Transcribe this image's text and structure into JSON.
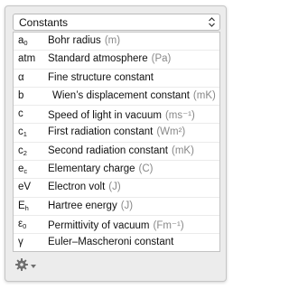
{
  "dropdown": {
    "label": "Constants",
    "icon": "chevron-up-down-icon"
  },
  "constants": [
    {
      "symbol": "a",
      "sub": "0",
      "name": "Bohr radius",
      "unit": "(m)"
    },
    {
      "symbol": "atm",
      "sub": "",
      "name": "Standard atmosphere",
      "unit": "(Pa)"
    },
    {
      "symbol": "α",
      "sub": "",
      "name": "Fine structure constant",
      "unit": ""
    },
    {
      "symbol": "b",
      "sub": "",
      "name": "Wien’s displacement constant",
      "unit": "(mK)"
    },
    {
      "symbol": "c",
      "sub": "",
      "name": "Speed of light in vacuum",
      "unit": "(ms⁻¹)"
    },
    {
      "symbol": "c",
      "sub": "1",
      "name": "First radiation constant",
      "unit": "(Wm²)"
    },
    {
      "symbol": "c",
      "sub": "2",
      "name": "Second radiation constant",
      "unit": "(mK)"
    },
    {
      "symbol": "e",
      "sub": "c",
      "name": "Elementary charge",
      "unit": "(C)"
    },
    {
      "symbol": "eV",
      "sub": "",
      "name": "Electron volt",
      "unit": "(J)"
    },
    {
      "symbol": "E",
      "sub": "h",
      "name": "Hartree energy",
      "unit": "(J)"
    },
    {
      "symbol": "ε",
      "sub": "0",
      "name": "Permittivity of vacuum",
      "unit": "(Fm⁻¹)"
    },
    {
      "symbol": "γ",
      "sub": "",
      "name": "Euler–Mascheroni constant",
      "unit": ""
    }
  ],
  "footer": {
    "action_icon": "gear-icon",
    "menu_icon": "caret-down-icon"
  }
}
